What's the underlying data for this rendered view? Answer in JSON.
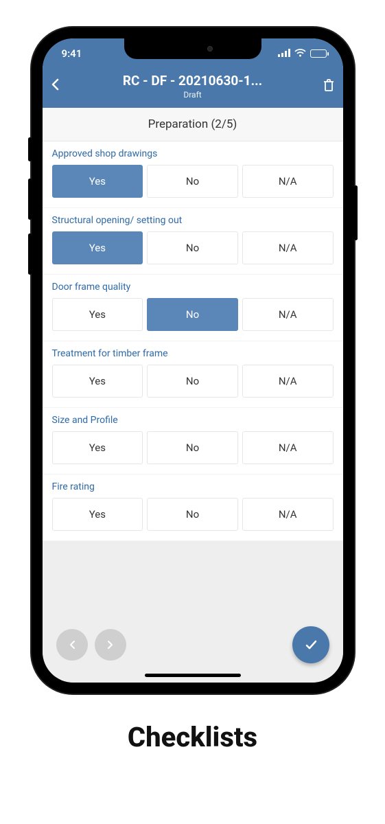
{
  "status": {
    "time": "9:41"
  },
  "header": {
    "title": "RC - DF - 20210630-1...",
    "subtitle": "Draft"
  },
  "section": {
    "title": "Preparation (2/5)"
  },
  "options": {
    "yes": "Yes",
    "no": "No",
    "na": "N/A"
  },
  "items": [
    {
      "label": "Approved shop drawings",
      "selected": "yes"
    },
    {
      "label": "Structural opening/ setting out",
      "selected": "yes"
    },
    {
      "label": "Door frame quality",
      "selected": "no"
    },
    {
      "label": "Treatment for timber frame",
      "selected": ""
    },
    {
      "label": "Size and Profile",
      "selected": ""
    },
    {
      "label": "Fire rating",
      "selected": ""
    }
  ],
  "caption": "Checklists"
}
